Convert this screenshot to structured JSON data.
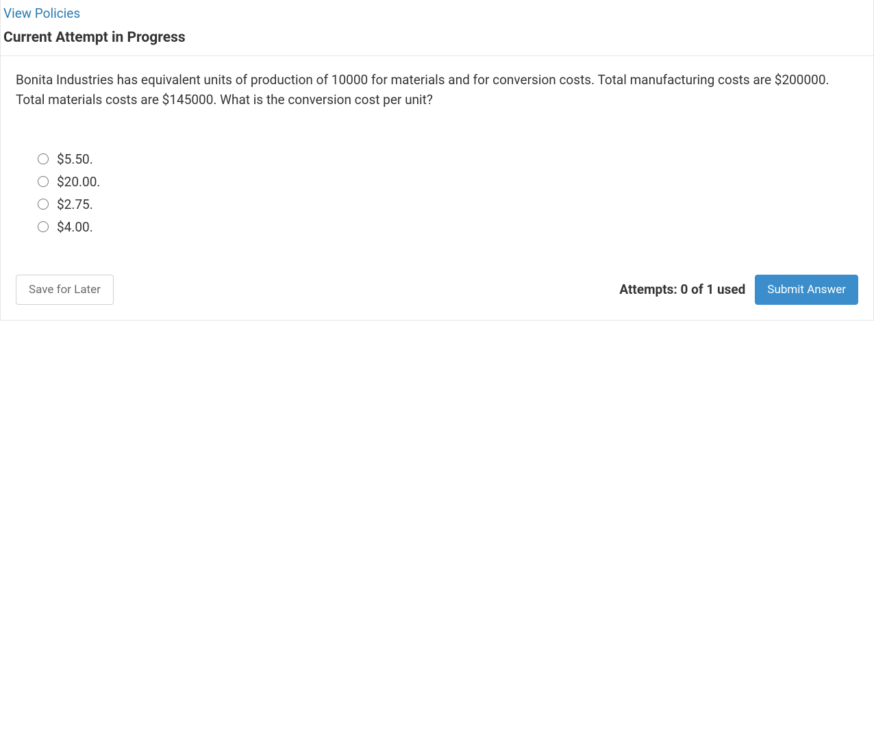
{
  "header": {
    "view_policies_label": "View Policies",
    "section_title": "Current Attempt in Progress"
  },
  "question": {
    "text": "Bonita Industries has equivalent units of production of 10000 for materials and for conversion costs. Total manufacturing costs are $200000. Total materials costs are $145000. What is the conversion cost per unit?"
  },
  "options": [
    {
      "label": "$5.50."
    },
    {
      "label": "$20.00."
    },
    {
      "label": "$2.75."
    },
    {
      "label": "$4.00."
    }
  ],
  "footer": {
    "save_label": "Save for Later",
    "attempts_text": "Attempts: 0 of 1 used",
    "submit_label": "Submit Answer"
  }
}
